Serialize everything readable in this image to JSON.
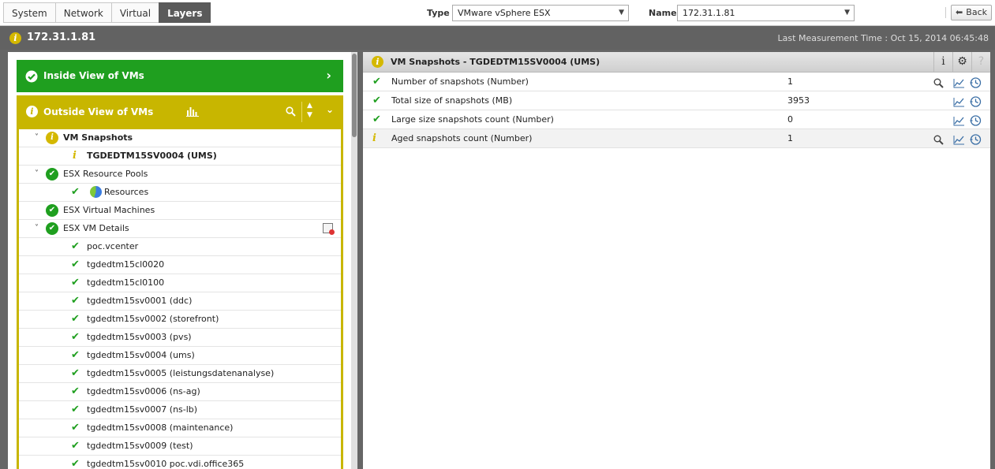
{
  "tabs": [
    "System",
    "Network",
    "Virtual",
    "Layers"
  ],
  "active_tab": "Layers",
  "type_label": "Type",
  "type_value": "VMware vSphere ESX",
  "name_label": "Name",
  "name_value": "172.31.1.81",
  "back_label": "Back",
  "header": {
    "host": "172.31.1.81",
    "last_measurement": "Last Measurement Time : Oct 15, 2014 06:45:48"
  },
  "left": {
    "inside_label": "Inside View of VMs",
    "outside_label": "Outside View of VMs",
    "tree": [
      {
        "label": "VM Snapshots",
        "status": "warn",
        "level": 0,
        "expanded": true,
        "bold": true
      },
      {
        "label": "TGDEDTM15SV0004 (UMS)",
        "status": "warn-small",
        "level": 1,
        "bold": true
      },
      {
        "label": "ESX Resource Pools",
        "status": "ok",
        "level": 0,
        "expanded": true
      },
      {
        "label": "Resources",
        "status": "ok-pie",
        "level": 1
      },
      {
        "label": "ESX Virtual Machines",
        "status": "ok",
        "level": 0
      },
      {
        "label": "ESX VM Details",
        "status": "ok",
        "level": 0,
        "expanded": true,
        "report": true
      },
      {
        "label": "poc.vcenter",
        "status": "tick",
        "level": 1
      },
      {
        "label": "tgdedtm15cl0020",
        "status": "tick",
        "level": 1
      },
      {
        "label": "tgdedtm15cl0100",
        "status": "tick",
        "level": 1
      },
      {
        "label": "tgdedtm15sv0001 (ddc)",
        "status": "tick",
        "level": 1
      },
      {
        "label": "tgdedtm15sv0002 (storefront)",
        "status": "tick",
        "level": 1
      },
      {
        "label": "tgdedtm15sv0003 (pvs)",
        "status": "tick",
        "level": 1
      },
      {
        "label": "tgdedtm15sv0004 (ums)",
        "status": "tick",
        "level": 1
      },
      {
        "label": "tgdedtm15sv0005 (leistungsdatenanalyse)",
        "status": "tick",
        "level": 1
      },
      {
        "label": "tgdedtm15sv0006 (ns-ag)",
        "status": "tick",
        "level": 1
      },
      {
        "label": "tgdedtm15sv0007 (ns-lb)",
        "status": "tick",
        "level": 1
      },
      {
        "label": "tgdedtm15sv0008 (maintenance)",
        "status": "tick",
        "level": 1
      },
      {
        "label": "tgdedtm15sv0009 (test)",
        "status": "tick",
        "level": 1
      },
      {
        "label": "tgdedtm15sv0010 poc.vdi.office365",
        "status": "tick",
        "level": 1
      }
    ]
  },
  "right": {
    "title": "VM Snapshots - TGDEDTM15SV0004 (UMS)",
    "measures": [
      {
        "name": "Number of snapshots (Number)",
        "value": "1",
        "status": "ok",
        "search": true
      },
      {
        "name": "Total size of snapshots (MB)",
        "value": "3953",
        "status": "ok",
        "search": false
      },
      {
        "name": "Large size snapshots count (Number)",
        "value": "0",
        "status": "ok",
        "search": false
      },
      {
        "name": "Aged snapshots count (Number)",
        "value": "1",
        "status": "warn",
        "search": true
      }
    ]
  }
}
